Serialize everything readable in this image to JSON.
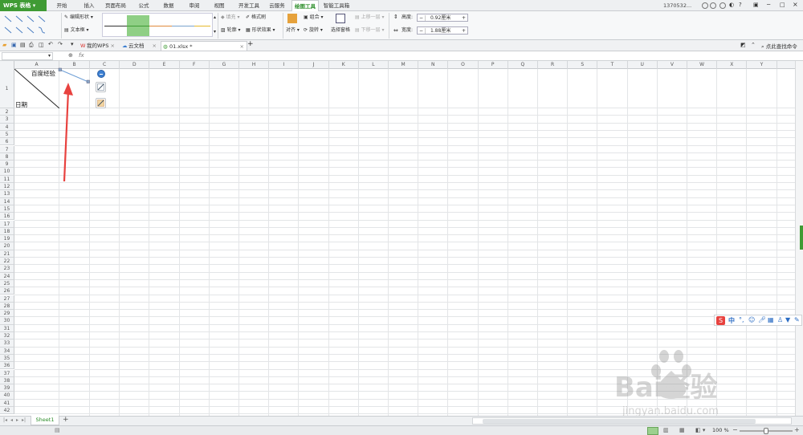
{
  "app": {
    "logo_label": "WPS 表格"
  },
  "menu_tabs": [
    "开始",
    "插入",
    "页面布局",
    "公式",
    "数据",
    "审阅",
    "视图",
    "开发工具",
    "云服务",
    "绘图工具",
    "智能工具箱"
  ],
  "active_tab_index": 9,
  "account": {
    "label": "1370532..."
  },
  "ribbon": {
    "edit_shape": "编辑形状",
    "text_box": "文本框",
    "fill": "填充",
    "format_painter": "格式刷",
    "outline": "轮廓",
    "shape_effects": "形状效果",
    "align": "对齐",
    "group": "组合",
    "rotate": "旋转",
    "selection_pane": "选择窗格",
    "bring_forward": "上移一层",
    "send_backward": "下移一层",
    "height_label": "高度:",
    "height_value": "0.92厘米",
    "width_label": "宽度:",
    "width_value": "1.88厘米"
  },
  "doc_tabs": [
    {
      "label": "我的WPS"
    },
    {
      "label": "云文档"
    },
    {
      "label": "01.xlsx *"
    }
  ],
  "search_label": "点此查找命令",
  "formula_bar": {
    "fx": "fx",
    "value": ""
  },
  "columns": [
    "A",
    "B",
    "C",
    "D",
    "E",
    "F",
    "G",
    "H",
    "I",
    "J",
    "K",
    "L",
    "M",
    "N",
    "O",
    "P",
    "Q",
    "R",
    "S",
    "T",
    "U",
    "V",
    "W",
    "X",
    "Y"
  ],
  "rows": [
    "1",
    "2",
    "3",
    "4",
    "5",
    "6",
    "7",
    "8",
    "9",
    "10",
    "11",
    "12",
    "13",
    "14",
    "15",
    "16",
    "17",
    "18",
    "19",
    "20",
    "21",
    "22",
    "23",
    "24",
    "25",
    "26",
    "27",
    "28",
    "29",
    "30",
    "31",
    "32",
    "33",
    "34",
    "35",
    "36",
    "37",
    "38",
    "39",
    "40",
    "41",
    "42"
  ],
  "cells": {
    "a1_top": "百度经验",
    "a1_bottom": "日期"
  },
  "sheet_tabs": [
    "Sheet1"
  ],
  "status": {
    "zoom": "100 %"
  },
  "ime": {
    "mode": "中"
  },
  "watermark": {
    "brand": "Bai经验",
    "url": "jingyan.baidu.com"
  },
  "colors": {
    "accent": "#3f9b34",
    "arrow": "#e8423f"
  }
}
